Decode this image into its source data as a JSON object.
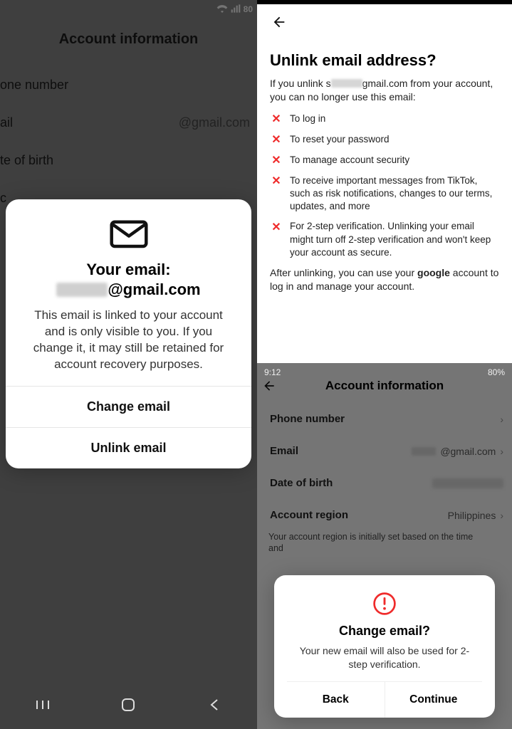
{
  "left": {
    "status": {
      "battery": "80"
    },
    "page_title": "Account information",
    "rows": {
      "phone_label": "one number",
      "email_label": "ail",
      "email_value": "@gmail.com",
      "dob_label": "te of birth",
      "other_label": "c"
    },
    "modal": {
      "title_line1": "Your email:",
      "email_suffix": "@gmail.com",
      "body": "This email is linked to your account and is only visible to you. If you change it, it may still be retained for account recovery purposes.",
      "change_btn": "Change email",
      "unlink_btn": "Unlink email"
    }
  },
  "right_top": {
    "heading": "Unlink email address?",
    "lead_prefix": "If you unlink s",
    "lead_suffix": "gmail.com from your account, you can no longer use this email:",
    "items": [
      "To log in",
      "To reset your password",
      "To manage account security",
      "To receive important messages from TikTok, such as risk notifications, changes to our terms, updates, and more",
      "For 2-step verification. Unlinking your email might turn off 2-step verification and won't keep your account as secure."
    ],
    "after_prefix": "After unlinking, you can use your ",
    "after_bold": "google",
    "after_suffix": " account to log in and manage your account."
  },
  "right_bottom": {
    "status": {
      "time": "9:12",
      "battery": "80%"
    },
    "title": "Account information",
    "rows": {
      "phone_label": "Phone number",
      "email_label": "Email",
      "email_value": "@gmail.com",
      "dob_label": "Date of birth",
      "region_label": "Account region",
      "region_value": "Philippines"
    },
    "note_line1": "Your account region is initially set based on the time",
    "note_line2": "and",
    "dialog": {
      "title": "Change email?",
      "body": "Your new email will also be used for 2-step verification.",
      "back": "Back",
      "continue": "Continue"
    }
  }
}
